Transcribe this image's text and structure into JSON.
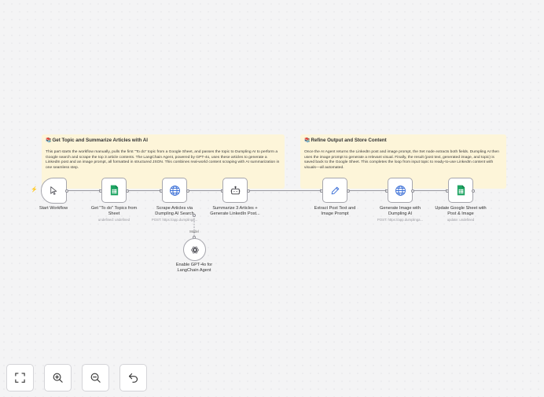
{
  "notes": [
    {
      "emoji": "📚",
      "title": "Get Topic and Summarize Articles with AI",
      "body": "This part starts the workflow manually, pulls the first \"To do\" topic from a Google Sheet, and passes the topic to Dumpling AI to perform a Google search and scrape the top 3 article contents. The LangChain Agent, powered by GPT-4o, uses these articles to generate a LinkedIn post and an image prompt, all formatted in structured JSON. This combines real-world content scraping with AI summarization in one seamless step."
    },
    {
      "emoji": "📚",
      "title": "Refine Output and Store Content",
      "body": "Once the AI Agent returns the LinkedIn post and image prompt, the Set node extracts both fields. Dumpling AI then uses the image prompt to generate a relevant visual. Finally, the result (post text, generated image, and topic) is saved back to the Google Sheet. This completes the loop from input topic to ready-to-use LinkedIn content with visuals—all automated."
    }
  ],
  "nodes": [
    {
      "icon": "cursor-icon",
      "label": "Start Workflow",
      "sub": ""
    },
    {
      "icon": "google-sheets-icon",
      "label": "Get \"To do\" Topics from Sheet",
      "sub": "undefined: undefined"
    },
    {
      "icon": "globe-icon",
      "label": "Scrape Articles via Dumpling AI Search",
      "sub": "POST: https://app.dumplinga..."
    },
    {
      "icon": "robot-icon",
      "label": "Summarize 3 Articles + Generate LinkedIn Post...",
      "sub": ""
    },
    {
      "icon": "pencil-icon",
      "label": "Extract Post Text and Image Prompt",
      "sub": ""
    },
    {
      "icon": "globe-icon",
      "label": "Generate Image with Dumpling AI",
      "sub": "POST: https://app.dumplinga..."
    },
    {
      "icon": "google-sheets-icon",
      "label": "Update Google Sheet with Post & Image",
      "sub": "update: undefined"
    }
  ],
  "model_node": {
    "icon": "openai-icon",
    "label": "Enable GPT-4o for LangChain Agent",
    "port_label": "Model"
  },
  "controls": [
    {
      "icon": "fit-view-icon"
    },
    {
      "icon": "zoom-in-icon"
    },
    {
      "icon": "zoom-out-icon"
    },
    {
      "icon": "undo-icon"
    }
  ],
  "colors": {
    "note_bg": "#fdf5d9",
    "sheets_green": "#1fa463",
    "globe_blue": "#3b6fd6",
    "trigger_red": "#ff6d5a"
  }
}
